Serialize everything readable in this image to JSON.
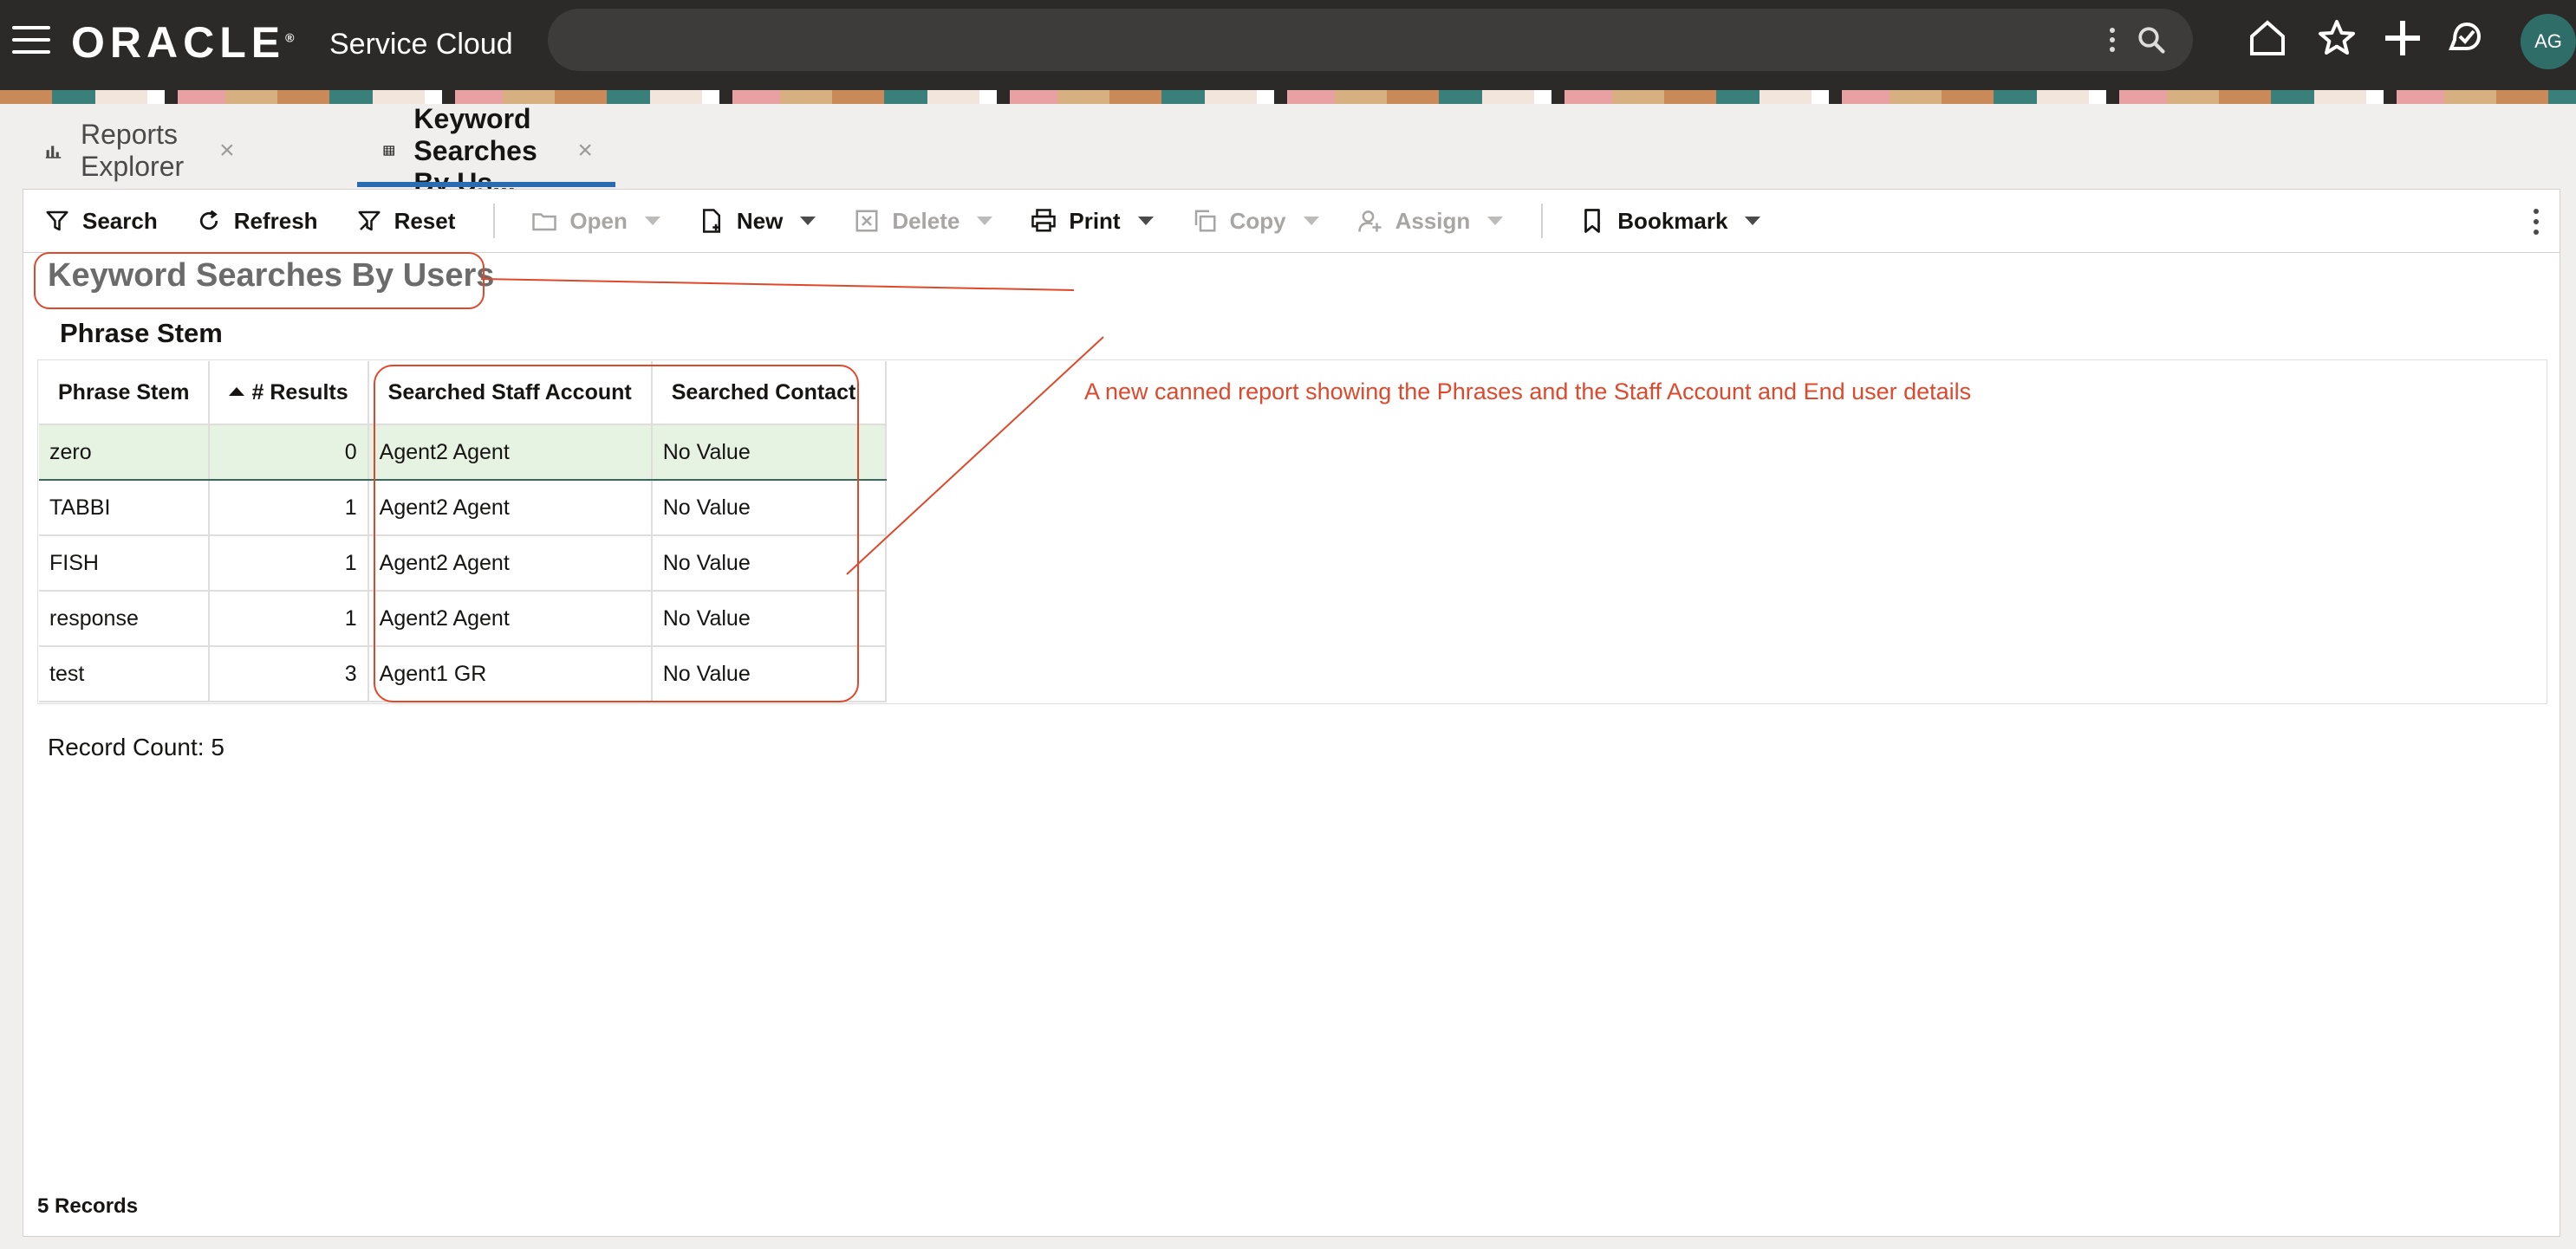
{
  "header": {
    "logo": "ORACLE",
    "logo_mark": "®",
    "product": "Service Cloud",
    "avatar": "AG"
  },
  "tabs": [
    {
      "label": "Reports Explorer",
      "close": "×"
    },
    {
      "label": "Keyword Searches By Us...",
      "close": "×"
    }
  ],
  "toolbar": {
    "search": "Search",
    "refresh": "Refresh",
    "reset": "Reset",
    "open": "Open",
    "new": "New",
    "delete": "Delete",
    "print": "Print",
    "copy": "Copy",
    "assign": "Assign",
    "bookmark": "Bookmark"
  },
  "report": {
    "title": "Keyword Searches By Users",
    "section": "Phrase Stem",
    "annotation": "A new canned report showing the Phrases and the Staff Account and End user details",
    "columns": [
      "Phrase Stem",
      "# Results",
      "Searched Staff Account",
      "Searched Contact"
    ],
    "rows": [
      [
        "zero",
        "0",
        "Agent2 Agent",
        "No Value"
      ],
      [
        "TABBI",
        "1",
        "Agent2 Agent",
        "No Value"
      ],
      [
        "FISH",
        "1",
        "Agent2 Agent",
        "No Value"
      ],
      [
        "response",
        "1",
        "Agent2 Agent",
        "No Value"
      ],
      [
        "test",
        "3",
        "Agent1 GR",
        "No Value"
      ]
    ],
    "record_count": "Record Count: 5",
    "footer": "5 Records"
  },
  "colors": {
    "header_bg": "#2b2a28",
    "annotation": "#e0482c",
    "tab_underline": "#2b6cb0",
    "selected_row": "#e7f3e2"
  }
}
